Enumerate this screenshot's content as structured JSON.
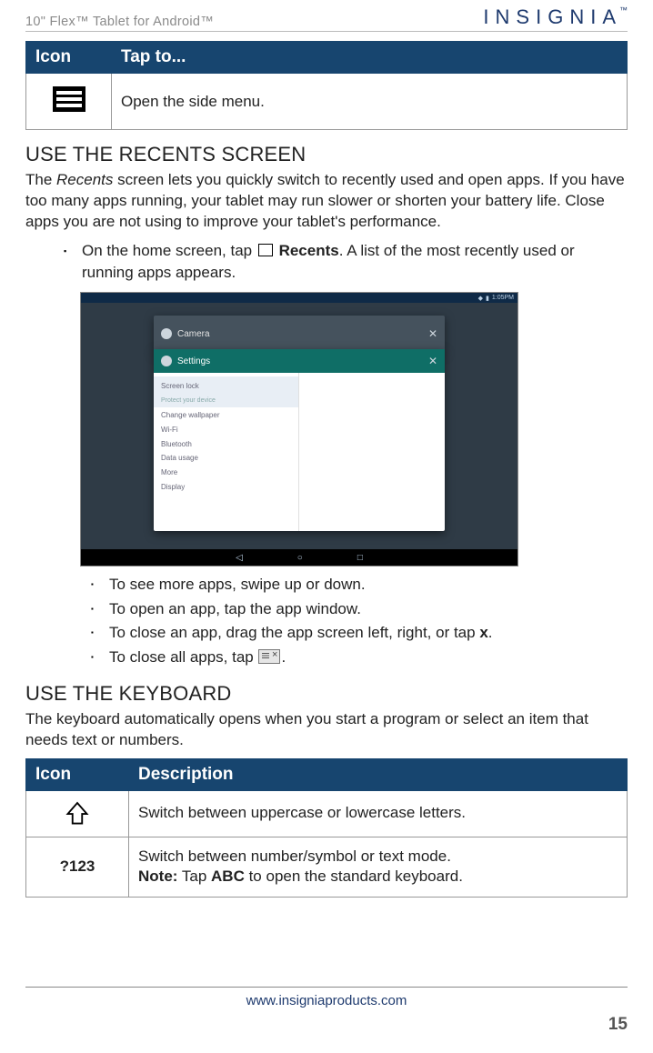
{
  "header": {
    "product": "10\" Flex™ Tablet for Android™",
    "brand": "INSIGNIA",
    "brand_tm": "™"
  },
  "table1": {
    "th_icon": "Icon",
    "th_tap": "Tap to...",
    "row1_desc": "Open the side menu."
  },
  "section1": {
    "title": "USE THE RECENTS SCREEN",
    "p1_a": "The ",
    "p1_italic": "Recents",
    "p1_b": " screen lets you quickly switch to recently used and open apps. If you have too many apps running, your tablet may run slower or shorten your battery life. Close apps you are not using to improve your tablet's performance.",
    "bullet1_a": "On the home screen, tap ",
    "bullet1_bold": "Recents",
    "bullet1_b": ". A list of the most recently used or running apps appears."
  },
  "screenshot": {
    "status_time": "1:05PM",
    "camera_label": "Camera",
    "settings_label": "Settings",
    "left_items": [
      "Screen lock",
      "Change wallpaper",
      "Wi-Fi",
      "Bluetooth",
      "Data usage",
      "More",
      "Display"
    ],
    "left_hl_sub": "Protect your device",
    "nav_back": "◁",
    "nav_home": "○",
    "nav_recents": "□"
  },
  "inner_bullets": {
    "b1": "To see more apps, swipe up or down.",
    "b2": "To open an app, tap the app window.",
    "b3_a": "To close an app, drag the app screen left, right, or tap ",
    "b3_bold": "x",
    "b3_b": ".",
    "b4_a": "To close all apps, tap ",
    "b4_b": "."
  },
  "section2": {
    "title": "USE THE KEYBOARD",
    "p1": "The keyboard automatically opens when you start a program or select an item that needs text or numbers."
  },
  "table2": {
    "th_icon": "Icon",
    "th_desc": "Description",
    "row1_desc": "Switch between uppercase or lowercase letters.",
    "row2_icon": "?123",
    "row2_line1": "Switch between number/symbol or text mode.",
    "row2_note_label": "Note:",
    "row2_note_a": " Tap ",
    "row2_note_bold": "ABC",
    "row2_note_b": " to open the standard keyboard."
  },
  "footer": {
    "url": "www.insigniaproducts.com",
    "page": "15"
  }
}
